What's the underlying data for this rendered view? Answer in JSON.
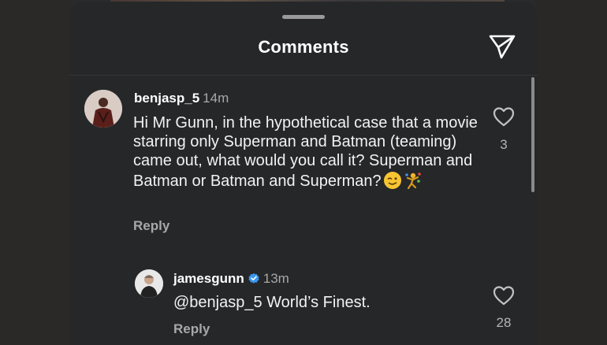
{
  "header": {
    "title": "Comments",
    "share_icon": "paper-plane-icon"
  },
  "comments": [
    {
      "username": "benjasp_5",
      "time": "14m",
      "text": "Hi Mr Gunn, in the hypothetical case that a movie starring only Superman and Batman (teaming) came out, what would you call it? Superman and Batman or Batman and Superman?",
      "emojis": [
        "winking-face-emoji",
        "person-juggling-emoji"
      ],
      "reply_label": "Reply",
      "like_count": "3",
      "verified": false
    },
    {
      "username": "jamesgunn",
      "time": "13m",
      "text": "@benjasp_5 World’s Finest.",
      "reply_label": "Reply",
      "like_count": "28",
      "verified": true
    }
  ],
  "colors": {
    "sheet_bg": "#262729",
    "verified_blue": "#3897f0",
    "secondary_text": "#a8a8a8"
  }
}
